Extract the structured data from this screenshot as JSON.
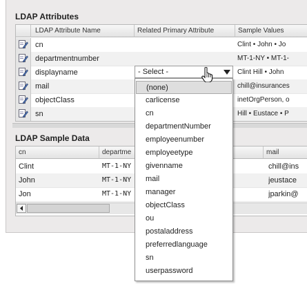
{
  "attributes": {
    "title": "LDAP Attributes",
    "columns": [
      "LDAP Attribute Name",
      "Related Primary Attribute",
      "Sample Values"
    ],
    "rows": [
      {
        "name": "cn",
        "related": "",
        "sample": "Clint • John • Jo"
      },
      {
        "name": "departmentnumber",
        "related": "",
        "sample": "MT-1-NY • MT-1-"
      },
      {
        "name": "displayname",
        "related": "- Select -",
        "sample": "Clint Hill • John"
      },
      {
        "name": "mail",
        "related": "",
        "sample": "chill@insurances"
      },
      {
        "name": "objectClass",
        "related": "",
        "sample": "inetOrgPerson, o"
      },
      {
        "name": "sn",
        "related": "",
        "sample": "Hill • Eustace • P"
      }
    ]
  },
  "sample_data": {
    "title": "LDAP Sample Data",
    "columns": [
      "cn",
      "departme",
      "mail"
    ],
    "rows": [
      {
        "cn": "Clint",
        "dept": "MT-1-NY",
        "mail": "chill@ins"
      },
      {
        "cn": "John",
        "dept": "MT-1-NY",
        "mail": "jeustace"
      },
      {
        "cn": "Jon",
        "dept": "MT-1-NY",
        "mail": "jparkin@"
      }
    ]
  },
  "dropdown": {
    "selected": "(none)",
    "options": [
      "(none)",
      "carlicense",
      "cn",
      "departmentNumber",
      "employeenumber",
      "employeetype",
      "givenname",
      "mail",
      "manager",
      "objectClass",
      "ou",
      "postaladdress",
      "preferredlanguage",
      "sn",
      "userpassword"
    ]
  },
  "icons": {
    "row_icon": "edit-attribute-icon",
    "select_arrow": "triangle-down-icon",
    "cursor": "hand-pointer-icon",
    "scroll_left": "scroll-left-arrow-icon"
  }
}
